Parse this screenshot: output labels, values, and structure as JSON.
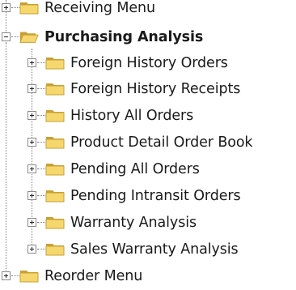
{
  "tree": {
    "items": [
      {
        "label": "Receiving Menu",
        "state": "collapsed",
        "level": 0,
        "icon": "folder-closed-icon"
      },
      {
        "label": "Purchasing Analysis",
        "state": "expanded",
        "level": 0,
        "icon": "folder-open-icon"
      },
      {
        "label": "Foreign History Orders",
        "state": "collapsed",
        "level": 1,
        "icon": "folder-closed-icon"
      },
      {
        "label": "Foreign History Receipts",
        "state": "collapsed",
        "level": 1,
        "icon": "folder-closed-icon"
      },
      {
        "label": "History All Orders",
        "state": "collapsed",
        "level": 1,
        "icon": "folder-closed-icon"
      },
      {
        "label": "Product Detail Order Book",
        "state": "collapsed",
        "level": 1,
        "icon": "folder-closed-icon"
      },
      {
        "label": "Pending All Orders",
        "state": "collapsed",
        "level": 1,
        "icon": "folder-closed-icon"
      },
      {
        "label": "Pending Intransit Orders",
        "state": "collapsed",
        "level": 1,
        "icon": "folder-closed-icon"
      },
      {
        "label": "Warranty Analysis",
        "state": "collapsed",
        "level": 1,
        "icon": "folder-closed-icon"
      },
      {
        "label": "Sales Warranty Analysis",
        "state": "collapsed",
        "level": 1,
        "icon": "folder-closed-icon"
      },
      {
        "label": "Reorder Menu",
        "state": "collapsed",
        "level": 0,
        "icon": "folder-closed-icon"
      }
    ]
  },
  "colors": {
    "folder_fill": "#f5d76e",
    "folder_dark": "#c8a033",
    "folder_back": "#e8c24a",
    "expander_border": "#8a8a8a",
    "connector": "#808080"
  }
}
